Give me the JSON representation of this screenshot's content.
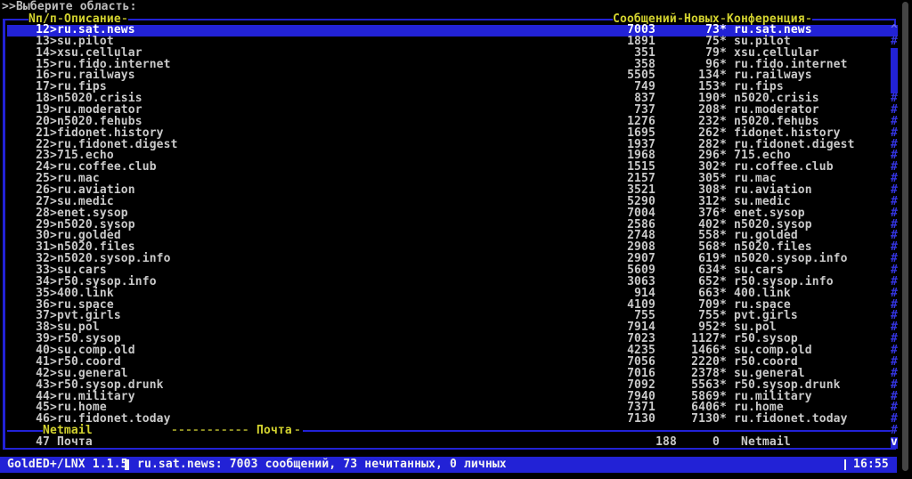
{
  "prompt": ">>Выберите область:",
  "glyphs": {
    "up": "^",
    "track": "#",
    "down": "v",
    "dash": "-"
  },
  "colors": {
    "background": "#000000",
    "frame_blue": "#2222d6",
    "selection_blue": "#2222d6",
    "label_yellow": "#d2d22f",
    "dash_olive": "#8f8f23",
    "text_grey": "#c9c9c9",
    "text_white": "#f4f4f4",
    "scroll_glyph_blue": "#3434e0",
    "terminal_scrollbar_grey": "#454545"
  },
  "panel": {
    "header": {
      "num_label": "Nп/п",
      "desc_label": "Описание",
      "msgs_label": "Сообщений",
      "new_label": "Новых",
      "conf_label": "Конференция"
    },
    "rows": [
      {
        "num": "12>",
        "desc": "ru.sat.news",
        "msgs": "7003",
        "new": "73*",
        "conf": "ru.sat.news",
        "scroll": "up",
        "selected": true
      },
      {
        "num": "13>",
        "desc": "su.pilot",
        "msgs": "1891",
        "new": "75*",
        "conf": "su.pilot",
        "scroll": "track"
      },
      {
        "num": "14>",
        "desc": "xsu.cellular",
        "msgs": "351",
        "new": "79*",
        "conf": "xsu.cellular",
        "scroll": "thumb"
      },
      {
        "num": "15>",
        "desc": "ru.fido.internet",
        "msgs": "358",
        "new": "96*",
        "conf": "ru.fido.internet",
        "scroll": "thumb"
      },
      {
        "num": "16>",
        "desc": "ru.railways",
        "msgs": "5505",
        "new": "134*",
        "conf": "ru.railways",
        "scroll": "thumb"
      },
      {
        "num": "17>",
        "desc": "ru.fips",
        "msgs": "749",
        "new": "153*",
        "conf": "ru.fips",
        "scroll": "thumb"
      },
      {
        "num": "18>",
        "desc": "n5020.crisis",
        "msgs": "837",
        "new": "190*",
        "conf": "n5020.crisis",
        "scroll": "track"
      },
      {
        "num": "19>",
        "desc": "ru.moderator",
        "msgs": "737",
        "new": "208*",
        "conf": "ru.moderator",
        "scroll": "track"
      },
      {
        "num": "20>",
        "desc": "n5020.fehubs",
        "msgs": "1276",
        "new": "232*",
        "conf": "n5020.fehubs",
        "scroll": "track"
      },
      {
        "num": "21>",
        "desc": "fidonet.history",
        "msgs": "1695",
        "new": "262*",
        "conf": "fidonet.history",
        "scroll": "track"
      },
      {
        "num": "22>",
        "desc": "ru.fidonet.digest",
        "msgs": "1937",
        "new": "282*",
        "conf": "ru.fidonet.digest",
        "scroll": "track"
      },
      {
        "num": "23>",
        "desc": "715.echo",
        "msgs": "1968",
        "new": "296*",
        "conf": "715.echo",
        "scroll": "track"
      },
      {
        "num": "24>",
        "desc": "ru.coffee.club",
        "msgs": "1515",
        "new": "302*",
        "conf": "ru.coffee.club",
        "scroll": "track"
      },
      {
        "num": "25>",
        "desc": "ru.mac",
        "msgs": "2157",
        "new": "305*",
        "conf": "ru.mac",
        "scroll": "track"
      },
      {
        "num": "26>",
        "desc": "ru.aviation",
        "msgs": "3521",
        "new": "308*",
        "conf": "ru.aviation",
        "scroll": "track"
      },
      {
        "num": "27>",
        "desc": "su.medic",
        "msgs": "5290",
        "new": "312*",
        "conf": "su.medic",
        "scroll": "track"
      },
      {
        "num": "28>",
        "desc": "enet.sysop",
        "msgs": "7004",
        "new": "376*",
        "conf": "enet.sysop",
        "scroll": "track"
      },
      {
        "num": "29>",
        "desc": "n5020.sysop",
        "msgs": "2586",
        "new": "402*",
        "conf": "n5020.sysop",
        "scroll": "track"
      },
      {
        "num": "30>",
        "desc": "ru.golded",
        "msgs": "2748",
        "new": "558*",
        "conf": "ru.golded",
        "scroll": "track"
      },
      {
        "num": "31>",
        "desc": "n5020.files",
        "msgs": "2908",
        "new": "568*",
        "conf": "n5020.files",
        "scroll": "track"
      },
      {
        "num": "32>",
        "desc": "n5020.sysop.info",
        "msgs": "2907",
        "new": "619*",
        "conf": "n5020.sysop.info",
        "scroll": "track"
      },
      {
        "num": "33>",
        "desc": "su.cars",
        "msgs": "5609",
        "new": "634*",
        "conf": "su.cars",
        "scroll": "track"
      },
      {
        "num": "34>",
        "desc": "r50.sysop.info",
        "msgs": "3063",
        "new": "652*",
        "conf": "r50.sysop.info",
        "scroll": "track"
      },
      {
        "num": "35>",
        "desc": "400.link",
        "msgs": "914",
        "new": "663*",
        "conf": "400.link",
        "scroll": "track"
      },
      {
        "num": "36>",
        "desc": "ru.space",
        "msgs": "4109",
        "new": "709*",
        "conf": "ru.space",
        "scroll": "track"
      },
      {
        "num": "37>",
        "desc": "pvt.girls",
        "msgs": "755",
        "new": "755*",
        "conf": "pvt.girls",
        "scroll": "track"
      },
      {
        "num": "38>",
        "desc": "su.pol",
        "msgs": "7914",
        "new": "952*",
        "conf": "su.pol",
        "scroll": "track"
      },
      {
        "num": "39>",
        "desc": "r50.sysop",
        "msgs": "7023",
        "new": "1127*",
        "conf": "r50.sysop",
        "scroll": "track"
      },
      {
        "num": "40>",
        "desc": "su.comp.old",
        "msgs": "4235",
        "new": "1466*",
        "conf": "su.comp.old",
        "scroll": "track"
      },
      {
        "num": "41>",
        "desc": "r50.coord",
        "msgs": "7056",
        "new": "2220*",
        "conf": "r50.coord",
        "scroll": "track"
      },
      {
        "num": "42>",
        "desc": "su.general",
        "msgs": "7016",
        "new": "2378*",
        "conf": "su.general",
        "scroll": "track"
      },
      {
        "num": "43>",
        "desc": "r50.sysop.drunk",
        "msgs": "7092",
        "new": "5563*",
        "conf": "r50.sysop.drunk",
        "scroll": "track"
      },
      {
        "num": "44>",
        "desc": "ru.military",
        "msgs": "7940",
        "new": "5869*",
        "conf": "ru.military",
        "scroll": "track"
      },
      {
        "num": "45>",
        "desc": "ru.home",
        "msgs": "7371",
        "new": "6406*",
        "conf": "ru.home",
        "scroll": "track"
      },
      {
        "num": "46>",
        "desc": "ru.fidonet.today",
        "msgs": "7130",
        "new": "7130*",
        "conf": "ru.fidonet.today",
        "scroll": "track"
      }
    ],
    "separator": {
      "left_label": "Netmail",
      "dashes": "-----------",
      "right_label": "Почта",
      "trailing_dash": "-"
    },
    "netmail_row": {
      "num": "47 ",
      "desc": "Почта",
      "msgs": "188",
      "new": "0",
      "conf": "Netmail",
      "scroll": "down"
    }
  },
  "statusbar": {
    "app": "GoldED+/LNX 1.1.5",
    "info": "ru.sat.news: 7003 сообщений, 73 нечитанных, 0 личных",
    "time": "16:55"
  }
}
